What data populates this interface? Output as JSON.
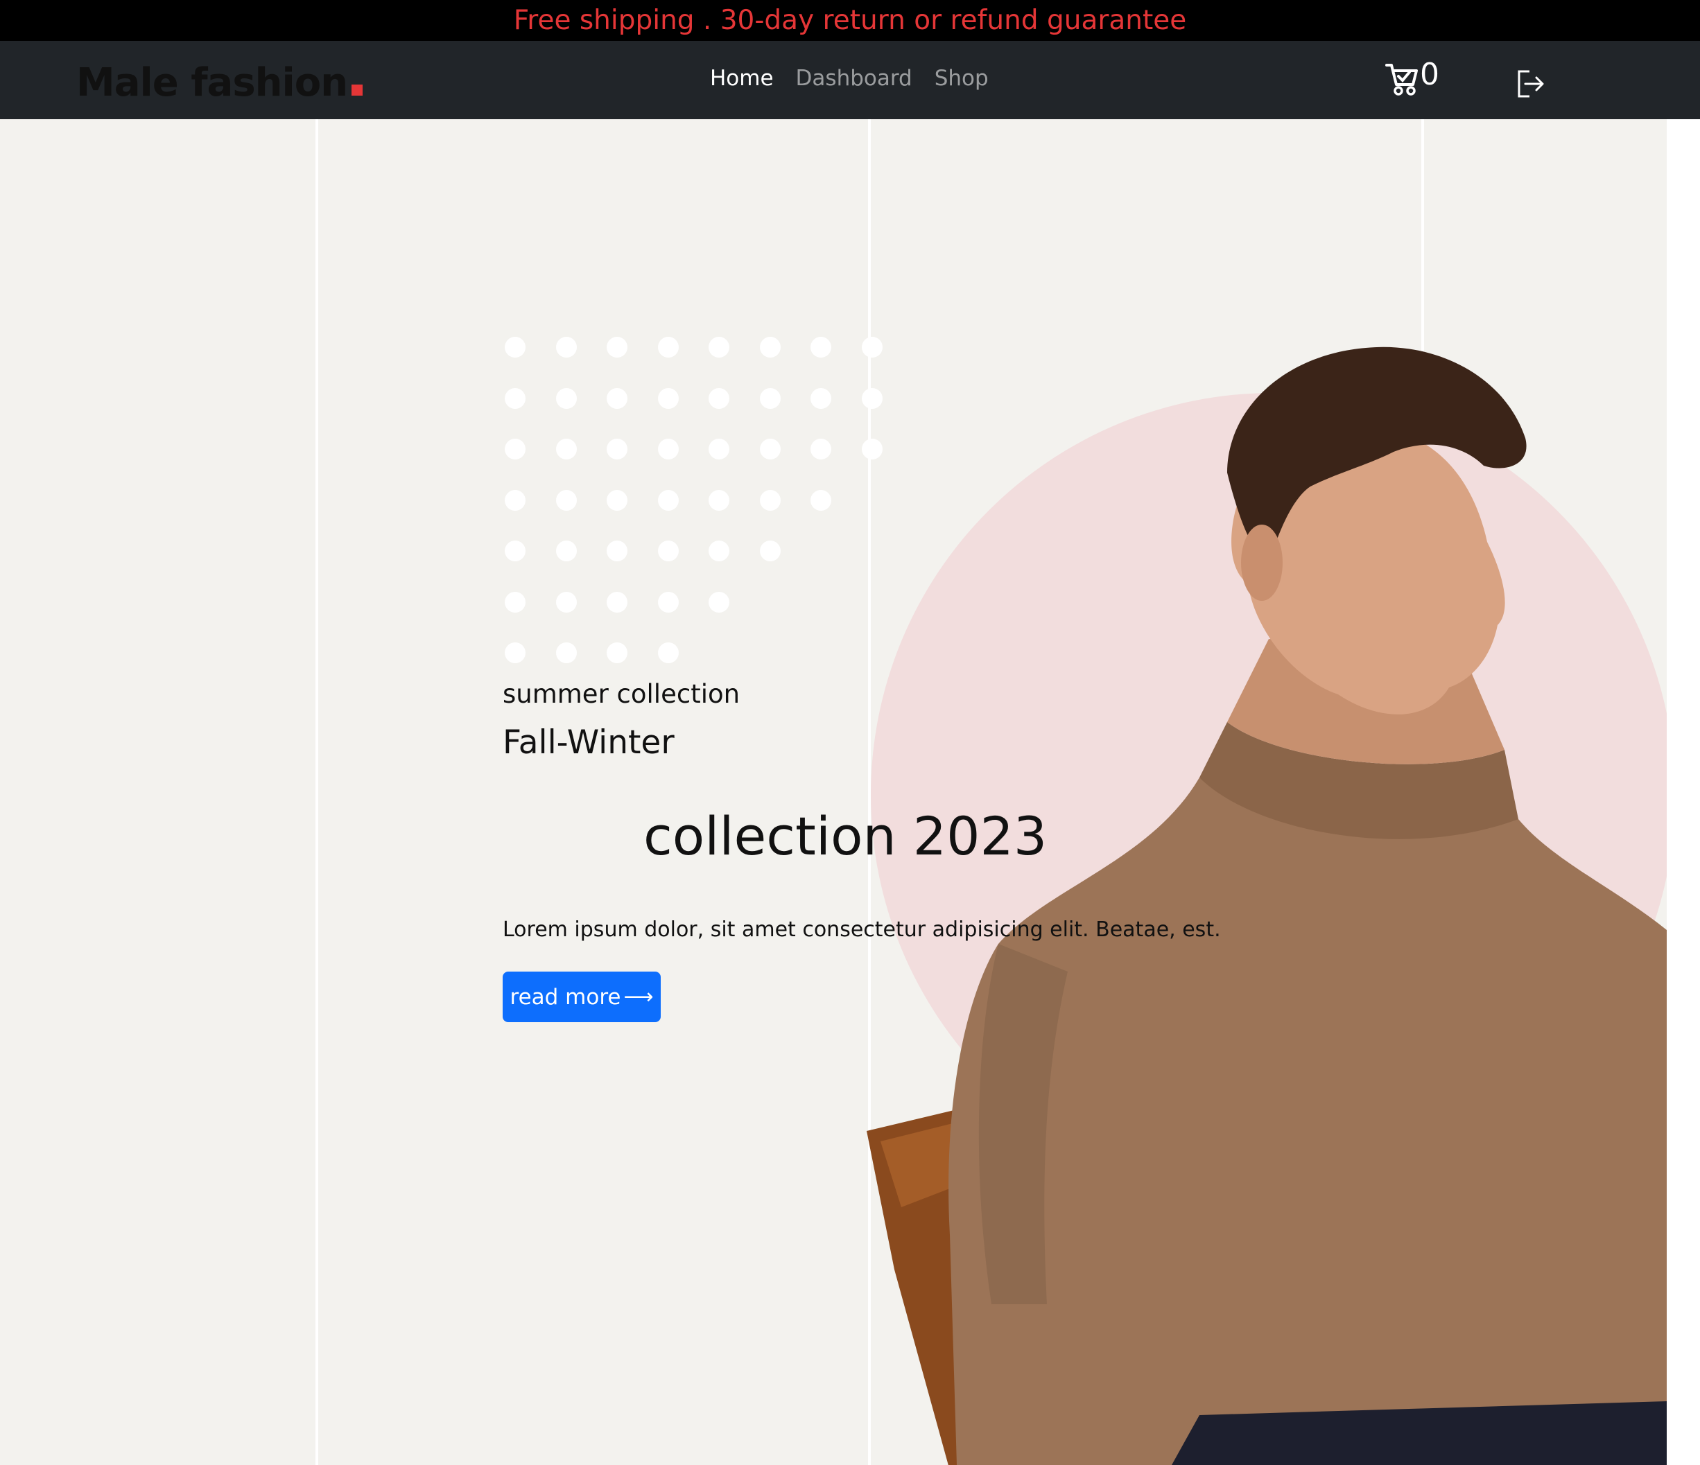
{
  "announcement": {
    "text": "Free shipping . 30-day return or refund guarantee"
  },
  "navbar": {
    "brand": "Male fashion",
    "links": [
      {
        "label": "Home",
        "active": true
      },
      {
        "label": "Dashboard",
        "active": false
      },
      {
        "label": "Shop",
        "active": false
      }
    ],
    "cart_count": "0",
    "cart_icon": "cart-icon",
    "logout_icon": "logout-icon"
  },
  "hero": {
    "subtitle": "summer collection",
    "title_line1": "Fall-Winter",
    "title_line2": "collection 2023",
    "description": "Lorem ipsum dolor, sit amet consectetur adipisicing elit. Beatae, est.",
    "button_label": "read more",
    "button_icon": "arrow-right-icon"
  },
  "colors": {
    "announcement_text": "#e53637",
    "navbar_bg": "#212529",
    "hero_bg": "#f3f2ee",
    "circle": "#f2dddd",
    "button": "#0d6efd",
    "brand_dot": "#e53637"
  }
}
